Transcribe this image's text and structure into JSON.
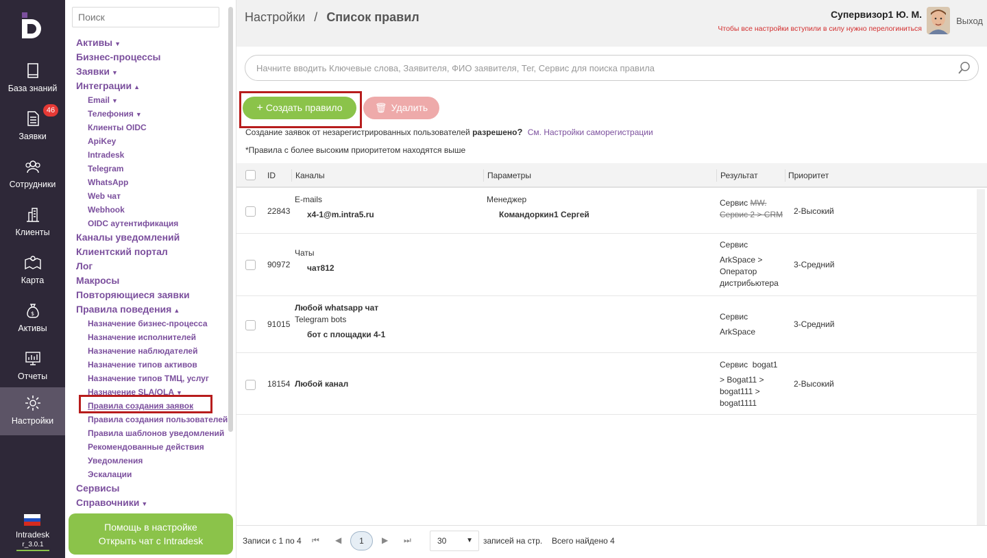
{
  "nav": {
    "items": [
      {
        "label": "База знаний",
        "icon": "book-icon"
      },
      {
        "label": "Заявки",
        "icon": "document-icon",
        "badge": "46"
      },
      {
        "label": "Сотрудники",
        "icon": "users-icon"
      },
      {
        "label": "Клиенты",
        "icon": "buildings-icon"
      },
      {
        "label": "Карта",
        "icon": "map-icon"
      },
      {
        "label": "Активы",
        "icon": "money-bag-icon"
      },
      {
        "label": "Отчеты",
        "icon": "report-icon"
      },
      {
        "label": "Настройки",
        "icon": "gear-icon"
      }
    ],
    "app_name": "Intradesk",
    "version": "r_3.0.1"
  },
  "tree": {
    "search_placeholder": "Поиск",
    "l_assets": "Активы",
    "l_bp": "Бизнес-процессы",
    "l_tickets": "Заявки",
    "l_integrations": "Интеграции",
    "i_email": "Email",
    "i_phone": "Телефония",
    "i_oidc_clients": "Клиенты OIDC",
    "i_apikey": "ApiKey",
    "i_intradesk": "Intradesk",
    "i_telegram": "Telegram",
    "i_whatsapp": "WhatsApp",
    "i_webchat": "Web чат",
    "i_webhook": "Webhook",
    "i_oidc_auth": "OIDC аутентификация",
    "l_notify_channels": "Каналы уведомлений",
    "l_portal": "Клиентский портал",
    "l_log": "Лог",
    "l_macros": "Макросы",
    "l_recurring": "Повторяющиеся заявки",
    "l_behavior": "Правила поведения",
    "b_bp_assign": "Назначение бизнес-процесса",
    "b_exec_assign": "Назначение исполнителей",
    "b_observers": "Назначение наблюдателей",
    "b_asset_types": "Назначение типов активов",
    "b_tmc_types": "Назначение типов ТМЦ, услуг",
    "b_sla": "Назначение SLA/OLA",
    "b_ticket_rules": "Правила создания заявок",
    "b_user_rules": "Правила создания пользователей",
    "b_tpl_rules": "Правила шаблонов уведомлений",
    "b_recommended": "Рекомендованные действия",
    "b_notifications": "Уведомления",
    "b_escalations": "Эскалации",
    "l_services": "Сервисы",
    "l_dicts": "Справочники",
    "help_line1": "Помощь в настройке",
    "help_line2": "Открыть чат с Intradesk"
  },
  "header": {
    "crumb_root": "Настройки",
    "crumb_sep": "/",
    "crumb_current": "Список правил",
    "user": "Супервизор1 Ю. М.",
    "relogin": "Чтобы все настройки вступили в силу нужно перелогиниться",
    "logout": "Выход"
  },
  "content": {
    "search_placeholder": "Начните вводить Ключевые слова, Заявителя, ФИО заявителя, Тег, Сервис для поиска правила",
    "create_btn": "Создать правило",
    "delete_btn": "Удалить",
    "selfreg_text": "Создание заявок от незарегистрированных пользователей",
    "selfreg_state": "разрешено",
    "selfreg_q": "?",
    "selfreg_link": "См. Настройки саморегистрации",
    "priority_note": "*Правила с более высоким приоритетом находятся выше",
    "columns": {
      "id": "ID",
      "channels": "Каналы",
      "params": "Параметры",
      "result": "Результат",
      "priority": "Приоритет"
    },
    "rows": [
      {
        "id": "22843",
        "ch_type": "E-mails",
        "ch_value": "x4-1@m.intra5.ru",
        "param_name": "Менеджер",
        "param_value": "Командоркин1 Сергей",
        "result_label": "Сервис",
        "result_s1": "MW.",
        "result_s2": "Сервис 2 > CRM",
        "priority": "2-Высокий"
      },
      {
        "id": "90972",
        "ch_type": "Чаты",
        "ch_value": "чат812",
        "result_label": "Сервис",
        "result_l2": "ArkSpace >",
        "result_l3": "Оператор",
        "result_l4": "дистрибьютера",
        "priority": "3-Средний"
      },
      {
        "id": "91015",
        "ch_any": "Любой whatsapp чат",
        "ch_type": "Telegram bots",
        "ch_value": "бот с площадки 4-1",
        "result_label": "Сервис",
        "result_l2": "ArkSpace",
        "priority": "3-Средний"
      },
      {
        "id": "18154",
        "ch_any": "Любой канал",
        "result_label": "Сервис",
        "result_l1b": "bogat1",
        "result_l2": "> Bogat11 >",
        "result_l3": "bogat111 >",
        "result_l4": "bogat1111",
        "priority": "2-Высокий"
      }
    ]
  },
  "pager": {
    "range": "Записи с 1 по 4",
    "first": "⏮",
    "prev": "◀",
    "current": "1",
    "next": "▶",
    "last": "⏭",
    "per_page": "30",
    "per_page_label": "записей на стр.",
    "total": "Всего найдено 4"
  }
}
